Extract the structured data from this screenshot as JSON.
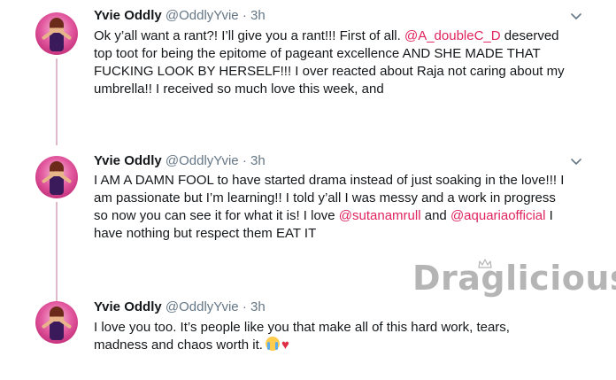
{
  "tweets": [
    {
      "name": "Yvie Oddly",
      "handle": "@OddlyYvie",
      "separator": "·",
      "time": "3h",
      "text_parts": [
        "Ok y’all want a rant?! I’ll give you a rant!!! First of all. ",
        "@A_doubleC_D",
        " deserved\ntop toot for being the epitome of pageant excellence AND SHE MADE THAT\nFUCKING LOOK BY HERSELF!!! I over reacted about Raja not caring about my\numbrella!! I received so much love this week, and"
      ]
    },
    {
      "name": "Yvie Oddly",
      "handle": "@OddlyYvie",
      "separator": "·",
      "time": "3h",
      "text_parts": [
        "I AM A DAMN FOOL to have started drama instead of just soaking in the love!!! I\nam passionate but I’m learning!! I told y’all I was messy and a work in progress\nso now you can see it for what it is! I love ",
        "@sutanamrull",
        " and ",
        "@aquariaofficial",
        " I\nhave nothing but respect them EAT IT"
      ]
    },
    {
      "name": "Yvie Oddly",
      "handle": "@OddlyYvie",
      "separator": "·",
      "time": "3h",
      "text_parts": [
        "I love you too. It’s people like you that make all of this hard work, tears,\nmadness and chaos worth it."
      ],
      "emoji": [
        "loudly-crying-face",
        "♥"
      ]
    }
  ],
  "watermark": "Draglicious",
  "colors": {
    "mention": "#e0245e",
    "secondary_text": "#657786",
    "thread_line": "#e1b8cc"
  },
  "icons": {
    "tweet_menu": "chevron-down-icon"
  }
}
